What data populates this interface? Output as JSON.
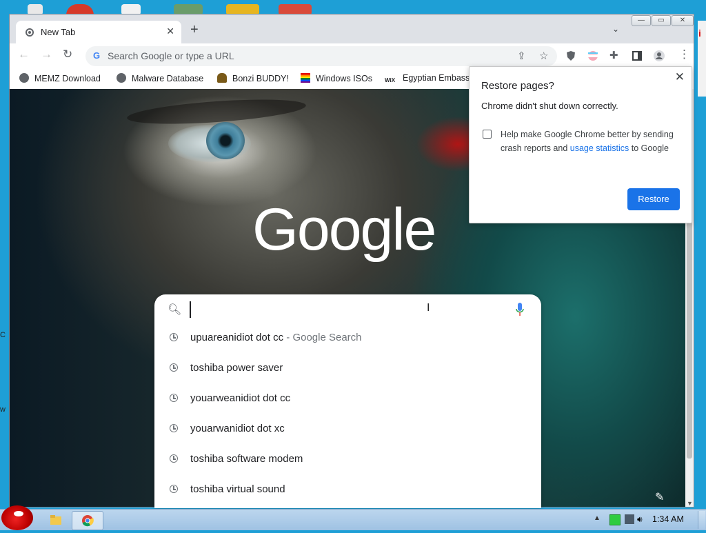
{
  "window": {
    "tab_title": "New Tab",
    "tab_close": "✕",
    "new_tab": "+",
    "tab_search": "⌄",
    "controls": {
      "minimize": "—",
      "restore": "▭",
      "close": "✕"
    }
  },
  "toolbar": {
    "back": "←",
    "forward": "→",
    "reload": "↻",
    "omnibox_placeholder": "Search Google or type a URL",
    "menu": "⋮"
  },
  "bookmarks": [
    {
      "label": "MEMZ Download",
      "icon": "globe-icon"
    },
    {
      "label": "Malware Database",
      "icon": "globe-icon"
    },
    {
      "label": "Bonzi BUDDY!",
      "icon": "bonzi-icon"
    },
    {
      "label": "Windows ISOs",
      "icon": "windows-flag-icon"
    },
    {
      "label": "Egyptian Embassy",
      "icon": "wix-icon"
    }
  ],
  "ntp": {
    "logo": "Google",
    "search_value": "",
    "suggestions": [
      {
        "text": "upuareanidiot dot cc",
        "suffix": " - Google Search"
      },
      {
        "text": "toshiba power saver",
        "suffix": ""
      },
      {
        "text": "youarweanidiot dot cc",
        "suffix": ""
      },
      {
        "text": "youarwanidiot dot xc",
        "suffix": ""
      },
      {
        "text": "toshiba software modem",
        "suffix": ""
      },
      {
        "text": "toshiba virtual sound",
        "suffix": ""
      }
    ]
  },
  "popup": {
    "title": "Restore pages?",
    "message": "Chrome didn't shut down correctly.",
    "checkbox_text": "Help make Google Chrome better by sending crash reports and",
    "checkbox_link": "usage statistics",
    "checkbox_tail": "to Google",
    "button": "Restore",
    "checked": false,
    "close": "✕"
  },
  "taskbar": {
    "clock": "1:34 AM"
  },
  "colors": {
    "accent": "#1a73e8",
    "desktop": "#1e9fd6"
  }
}
